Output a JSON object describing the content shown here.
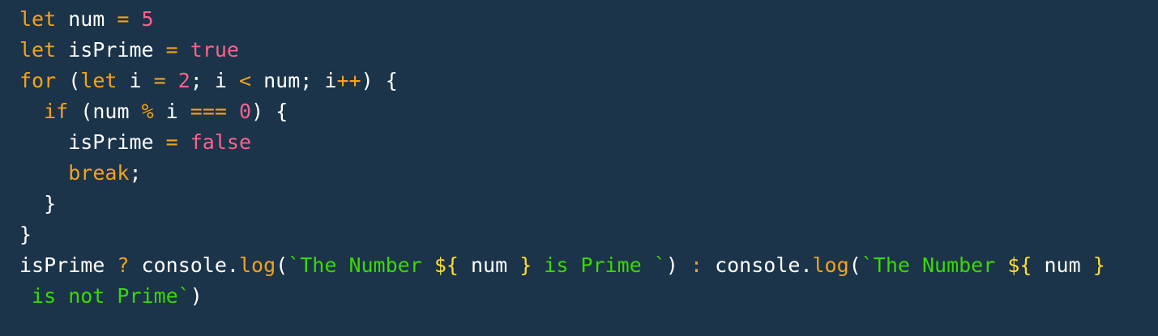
{
  "colors": {
    "background": "#1b3449",
    "plain": "#ffffff",
    "keyword": "#f5a21a",
    "operator": "#f5a21a",
    "number": "#ff628c",
    "boolean": "#ff628c",
    "function": "#f5a21a",
    "string": "#3ad900",
    "template": "#ffdd33",
    "punctuation": "#ffffff"
  },
  "lines": [
    [
      {
        "t": "kw",
        "v": "let"
      },
      {
        "t": "plain",
        "v": " num "
      },
      {
        "t": "op",
        "v": "="
      },
      {
        "t": "plain",
        "v": " "
      },
      {
        "t": "num",
        "v": "5"
      }
    ],
    [
      {
        "t": "kw",
        "v": "let"
      },
      {
        "t": "plain",
        "v": " isPrime "
      },
      {
        "t": "op",
        "v": "="
      },
      {
        "t": "plain",
        "v": " "
      },
      {
        "t": "bool",
        "v": "true"
      }
    ],
    [
      {
        "t": "kw",
        "v": "for"
      },
      {
        "t": "plain",
        "v": " "
      },
      {
        "t": "punc",
        "v": "("
      },
      {
        "t": "kw",
        "v": "let"
      },
      {
        "t": "plain",
        "v": " i "
      },
      {
        "t": "op",
        "v": "="
      },
      {
        "t": "plain",
        "v": " "
      },
      {
        "t": "num",
        "v": "2"
      },
      {
        "t": "punc",
        "v": ";"
      },
      {
        "t": "plain",
        "v": " i "
      },
      {
        "t": "op",
        "v": "<"
      },
      {
        "t": "plain",
        "v": " num"
      },
      {
        "t": "punc",
        "v": ";"
      },
      {
        "t": "plain",
        "v": " i"
      },
      {
        "t": "op",
        "v": "++"
      },
      {
        "t": "punc",
        "v": ")"
      },
      {
        "t": "plain",
        "v": " "
      },
      {
        "t": "punc",
        "v": "{"
      }
    ],
    [
      {
        "t": "plain",
        "v": "  "
      },
      {
        "t": "kw",
        "v": "if"
      },
      {
        "t": "plain",
        "v": " "
      },
      {
        "t": "punc",
        "v": "("
      },
      {
        "t": "plain",
        "v": "num "
      },
      {
        "t": "op",
        "v": "%"
      },
      {
        "t": "plain",
        "v": " i "
      },
      {
        "t": "op",
        "v": "==="
      },
      {
        "t": "plain",
        "v": " "
      },
      {
        "t": "num",
        "v": "0"
      },
      {
        "t": "punc",
        "v": ")"
      },
      {
        "t": "plain",
        "v": " "
      },
      {
        "t": "punc",
        "v": "{"
      }
    ],
    [
      {
        "t": "plain",
        "v": "    isPrime "
      },
      {
        "t": "op",
        "v": "="
      },
      {
        "t": "plain",
        "v": " "
      },
      {
        "t": "bool",
        "v": "false"
      }
    ],
    [
      {
        "t": "plain",
        "v": "    "
      },
      {
        "t": "kw",
        "v": "break"
      },
      {
        "t": "punc",
        "v": ";"
      }
    ],
    [
      {
        "t": "plain",
        "v": "  "
      },
      {
        "t": "punc",
        "v": "}"
      }
    ],
    [
      {
        "t": "punc",
        "v": "}"
      }
    ],
    [
      {
        "t": "plain",
        "v": "isPrime "
      },
      {
        "t": "op",
        "v": "?"
      },
      {
        "t": "plain",
        "v": " console"
      },
      {
        "t": "punc",
        "v": "."
      },
      {
        "t": "fn",
        "v": "log"
      },
      {
        "t": "punc",
        "v": "("
      },
      {
        "t": "str",
        "v": "`The Number "
      },
      {
        "t": "tpl",
        "v": "${"
      },
      {
        "t": "plain",
        "v": " num "
      },
      {
        "t": "tpl",
        "v": "}"
      },
      {
        "t": "str",
        "v": " is Prime `"
      },
      {
        "t": "punc",
        "v": ")"
      },
      {
        "t": "plain",
        "v": " "
      },
      {
        "t": "op",
        "v": ":"
      },
      {
        "t": "plain",
        "v": " console"
      },
      {
        "t": "punc",
        "v": "."
      },
      {
        "t": "fn",
        "v": "log"
      },
      {
        "t": "punc",
        "v": "("
      },
      {
        "t": "str",
        "v": "`The Number "
      },
      {
        "t": "tpl",
        "v": "${"
      },
      {
        "t": "plain",
        "v": " num "
      },
      {
        "t": "tpl",
        "v": "}"
      }
    ],
    [
      {
        "t": "str",
        "v": " is not Prime`"
      },
      {
        "t": "punc",
        "v": ")"
      }
    ]
  ]
}
